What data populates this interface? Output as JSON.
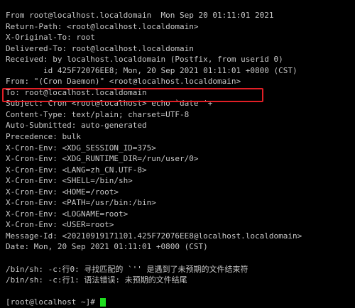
{
  "colors": {
    "background": "#000000",
    "text": "#c8c8c8",
    "highlight_border": "#e21f26",
    "cursor": "#1fde1f"
  },
  "terminal": {
    "lines": [
      "From root@localhost.localdomain  Mon Sep 20 01:11:01 2021",
      "Return-Path: <root@localhost.localdomain>",
      "X-Original-To: root",
      "Delivered-To: root@localhost.localdomain",
      "Received: by localhost.localdomain (Postfix, from userid 0)",
      "        id 425F72076EE8; Mon, 20 Sep 2021 01:11:01 +0800 (CST)",
      "From: \"(Cron Daemon)\" <root@localhost.localdomain>",
      "To: root@localhost.localdomain",
      "Subject: Cron <root@localhost> echo `date '+",
      "Content-Type: text/plain; charset=UTF-8",
      "Auto-Submitted: auto-generated",
      "Precedence: bulk",
      "X-Cron-Env: <XDG_SESSION_ID=375>",
      "X-Cron-Env: <XDG_RUNTIME_DIR=/run/user/0>",
      "X-Cron-Env: <LANG=zh_CN.UTF-8>",
      "X-Cron-Env: <SHELL=/bin/sh>",
      "X-Cron-Env: <HOME=/root>",
      "X-Cron-Env: <PATH=/usr/bin:/bin>",
      "X-Cron-Env: <LOGNAME=root>",
      "X-Cron-Env: <USER=root>",
      "Message-Id: <20210919171101.425F72076EE8@localhost.localdomain>",
      "Date: Mon, 20 Sep 2021 01:11:01 +0800 (CST)",
      "",
      "/bin/sh: -c:行0: 寻找匹配的 `'' 是遇到了未预期的文件结束符",
      "/bin/sh: -c:行1: 语法错误: 未预期的文件结尾",
      ""
    ],
    "prompt": "[root@localhost ~]# "
  }
}
